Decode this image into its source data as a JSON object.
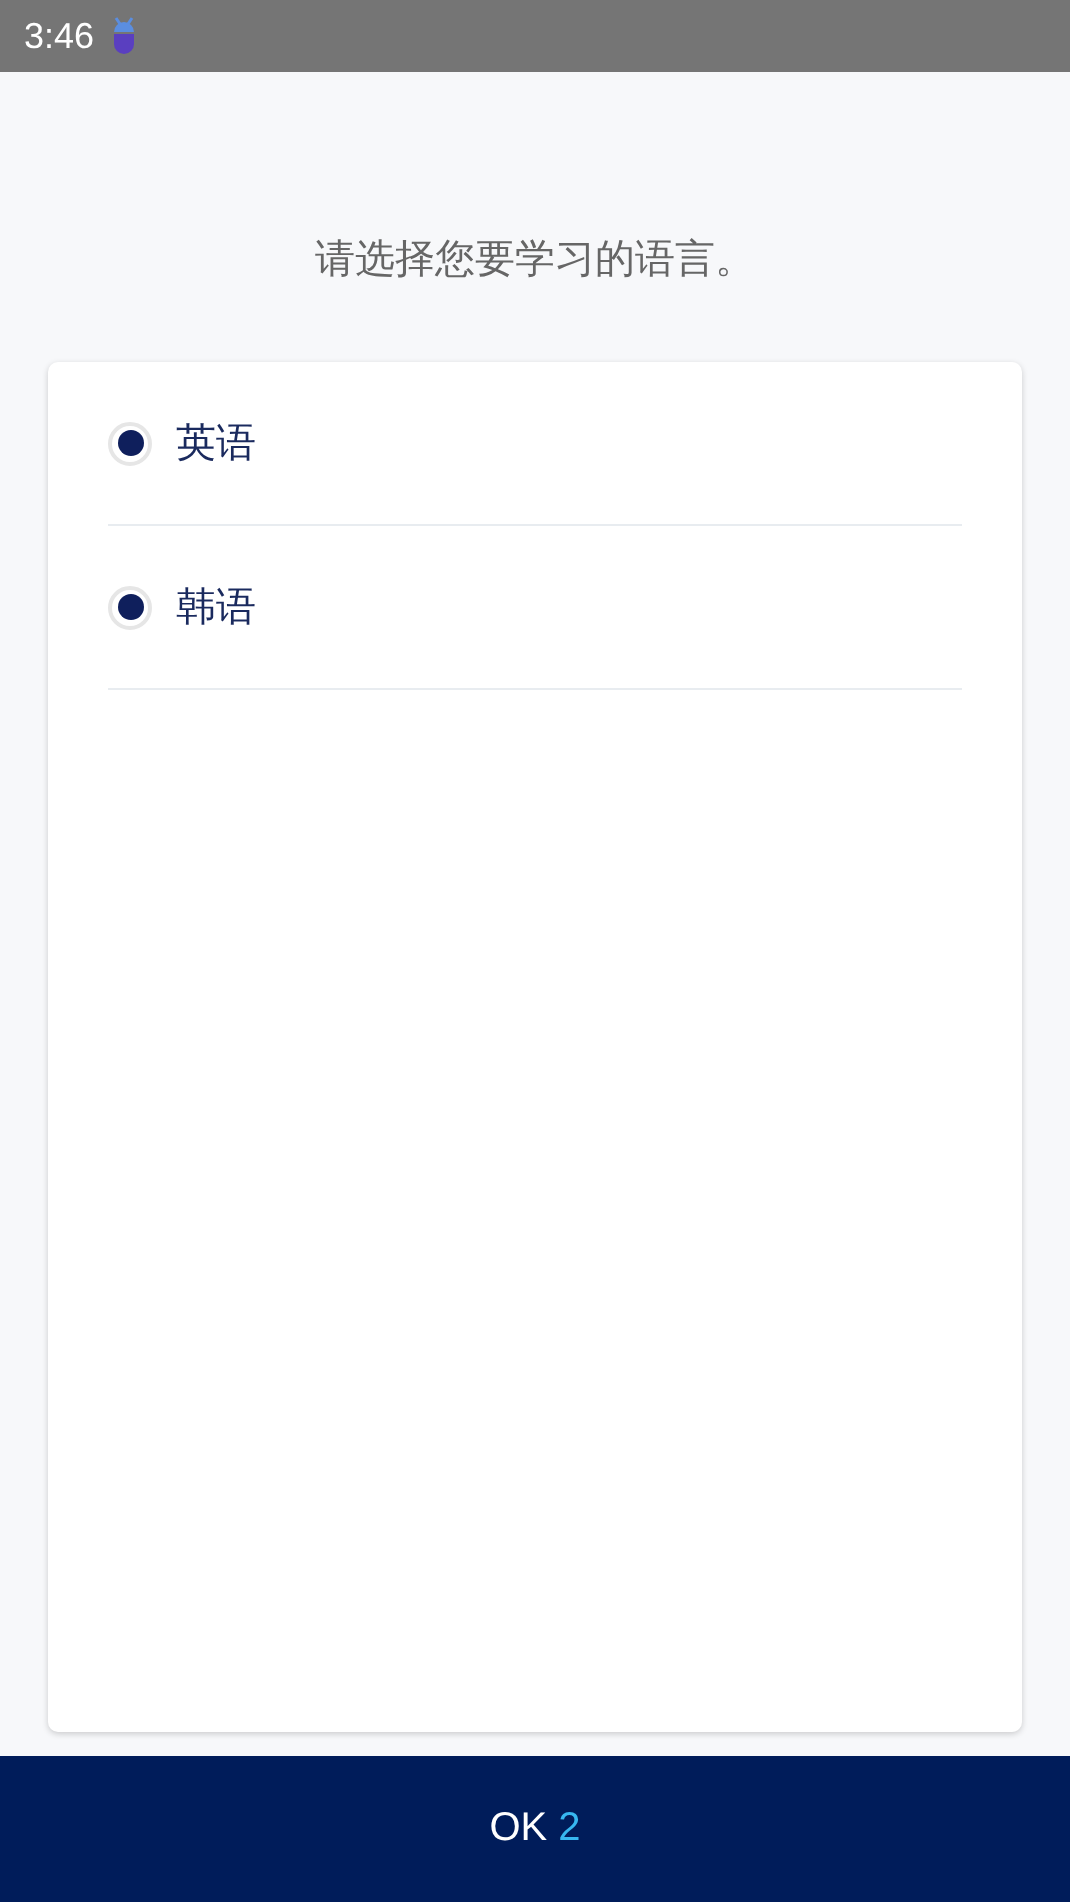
{
  "status_bar": {
    "time": "3:46"
  },
  "prompt": "请选择您要学习的语言。",
  "options": [
    {
      "label": "英语",
      "checked": true
    },
    {
      "label": "韩语",
      "checked": true
    }
  ],
  "ok_button": {
    "label": "OK",
    "count": "2"
  }
}
